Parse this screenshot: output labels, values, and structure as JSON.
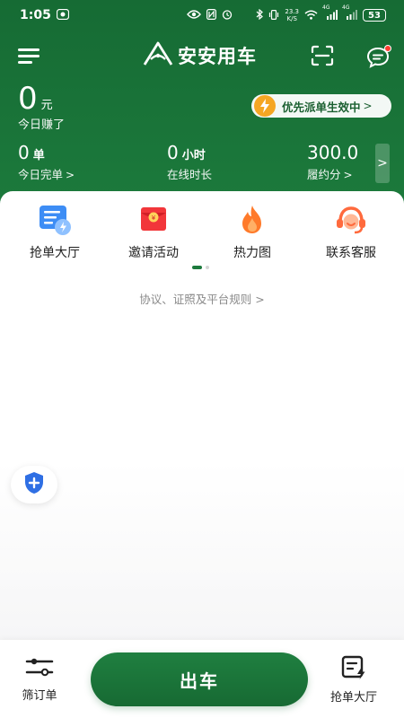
{
  "status_bar": {
    "time": "1:05",
    "net_speed_value": "23.3",
    "net_speed_unit": "K/S",
    "battery": "53",
    "signal1_label": "4G",
    "signal2_label": "4G"
  },
  "header": {
    "app_title": "安安用车"
  },
  "earnings": {
    "value": "0",
    "unit": "元",
    "label": "今日赚了"
  },
  "priority_pill": {
    "text": "优先派单生效中",
    "arrow": ">"
  },
  "stats": [
    {
      "value": "0",
      "unit": "单",
      "label": "今日完单",
      "arrow": ">"
    },
    {
      "value": "0",
      "unit": "小时",
      "label": "在线时长",
      "arrow": ""
    },
    {
      "value": "300.0",
      "unit": "",
      "label": "履约分",
      "arrow": ">"
    }
  ],
  "more_arrow": ">",
  "quick_actions": [
    {
      "label": "抢单大厅",
      "icon": "order-hall-icon"
    },
    {
      "label": "邀请活动",
      "icon": "red-envelope-icon"
    },
    {
      "label": "热力图",
      "icon": "flame-icon"
    },
    {
      "label": "联系客服",
      "icon": "customer-service-icon"
    }
  ],
  "rules_link": "协议、证照及平台规则 >",
  "bottom_bar": {
    "filter_label": "筛订单",
    "go_label": "出车",
    "hall_label": "抢单大厅"
  },
  "colors": {
    "brand_green": "#1c7a3c",
    "accent_orange": "#f5a623",
    "alert_red": "#ff3b30"
  }
}
